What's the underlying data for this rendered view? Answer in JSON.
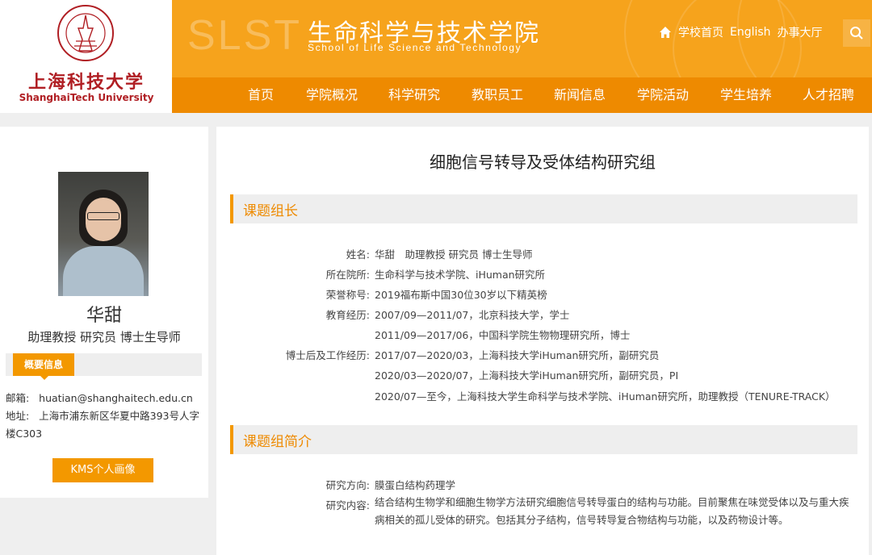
{
  "header": {
    "logo_cn": "上海科技大学",
    "logo_en": "ShanghaiTech University",
    "seal_text": "上海科技大学 SHANGHAITECH UNIVERSITY",
    "slst": "SLST",
    "title": "生命科学与技术学院",
    "subtitle": "School of Life Science and Technology",
    "links": [
      "学校首页",
      "English",
      "办事大厅"
    ],
    "brand_color": "#f39800"
  },
  "nav": [
    "首页",
    "学院概况",
    "科学研究",
    "教职员工",
    "新闻信息",
    "学院活动",
    "学生培养",
    "人才招聘"
  ],
  "profile": {
    "name": "华甜",
    "title": "助理教授 研究员 博士生导师",
    "info_tab": "概要信息",
    "email_label": "邮箱:",
    "email": "huatian@shanghaitech.edu.cn",
    "address_label": "地址:",
    "address": "上海市浦东新区华夏中路393号人字楼C303",
    "kms_button": "KMS个人画像"
  },
  "main": {
    "title": "细胞信号转导及受体结构研究组",
    "section1": "课题组长",
    "rows": [
      {
        "label": "姓名:",
        "value": "华甜　助理教授 研究员 博士生导师"
      },
      {
        "label": "所在院所:",
        "value": "生命科学与技术学院、iHuman研究所"
      },
      {
        "label": "荣誉称号:",
        "value": "2019福布斯中国30位30岁以下精英榜"
      },
      {
        "label": "教育经历:",
        "value": "2007/09—2011/07，北京科技大学，学士"
      },
      {
        "label": "",
        "value": "2011/09—2017/06，中国科学院生物物理研究所，博士"
      },
      {
        "label": "博士后及工作经历:",
        "value": "2017/07—2020/03，上海科技大学iHuman研究所，副研究员"
      },
      {
        "label": "",
        "value": "2020/03—2020/07，上海科技大学iHuman研究所，副研究员，PI"
      },
      {
        "label": "",
        "value": "2020/07—至今，上海科技大学生命科学与技术学院、iHuman研究所，助理教授（TENURE-TRACK）"
      }
    ],
    "section2": "课题组简介",
    "direction_label": "研究方向:",
    "direction": "膜蛋白结构药理学",
    "content_label": "研究内容:",
    "content": "结合结构生物学和细胞生物学方法研究细胞信号转导蛋白的结构与功能。目前聚焦在味觉受体以及与重大疾病相关的孤儿受体的研究。包括其分子结构，信号转导复合物结构与功能，以及药物设计等。"
  }
}
